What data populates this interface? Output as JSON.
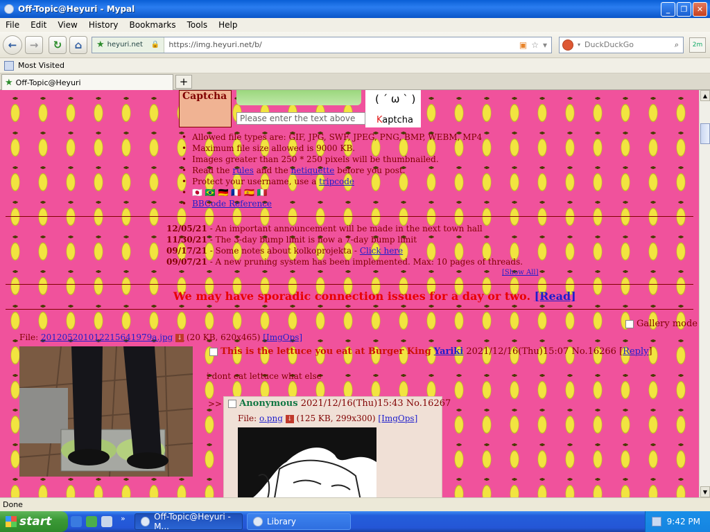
{
  "window": {
    "title": "Off-Topic@Heyuri - Mypal",
    "min": "_",
    "max": "❐",
    "close": "✕"
  },
  "menubar": [
    "File",
    "Edit",
    "View",
    "History",
    "Bookmarks",
    "Tools",
    "Help"
  ],
  "navbar": {
    "site": "heyuri.net",
    "url": "https://img.heyuri.net/b/",
    "search_placeholder": "DuckDuckGo",
    "end_btn": "2m"
  },
  "bookmarks": {
    "most_visited": "Most Visited"
  },
  "tab": {
    "title": "Off-Topic@Heyuri",
    "new_tab": "+"
  },
  "form": {
    "captcha_label": "Captcha",
    "captcha_placeholder": "Please enter the text above",
    "kaptcha_face": "( ´ ω ` )",
    "kaptcha_k": "K",
    "kaptcha_rest": "aptcha"
  },
  "rules": [
    "Allowed file types are: GIF, JPG, SWF, JPEG, PNG, BMP, WEBM, MP4",
    "Maximum file size allowed is 9000 KB.",
    "Images greater than 250 * 250 pixels will be thumbnailed.",
    {
      "pre": "Read the ",
      "l1": "rules",
      "mid": " and the ",
      "l2": "netiquette",
      "post": " before you post."
    },
    {
      "pre": "Protect your username, use a ",
      "l1": "tripcode"
    },
    "🇯🇵 🇧🇷 🇩🇪 🇫🇷 🇪🇸 🇮🇹",
    {
      "l1": "BBCode Reference"
    }
  ],
  "news": [
    {
      "date": "12/05/21",
      "text": " - An important announcement will be made in the next town hall"
    },
    {
      "date": "11/30/21",
      "text": " - The 3-day bump limit is now a 7-day bump limit"
    },
    {
      "date": "09/17/21",
      "text": " - Some notes about kolkoprojekta - ",
      "link": "Click here"
    },
    {
      "date": "09/07/21",
      "text": " - A new pruning system has been implemented. Max: 10 pages of threads."
    }
  ],
  "show_all": "[Show All]",
  "banner": {
    "text": "We may have sporadic connection issues for a day or two. ",
    "link": "[Read]"
  },
  "gallery": "Gallery mode",
  "thread": {
    "file_label": "File: ",
    "file_name": "201205201012215641979a.jpg",
    "file_meta": " (20 KB, 620x465) ",
    "imgops": "[ImgOps]",
    "subject": "This is the lettuce you eat at Burger King",
    "name": "Yariki",
    "datetime": "2021/12/16(Thu)15:07",
    "no": "No.16266",
    "reply": "Reply",
    "body": "i dont eat lettuce what else"
  },
  "reply": {
    "arrow": ">>",
    "name": "Anonymous",
    "datetime": "2021/12/16(Thu)15:43",
    "no": "No.16267",
    "file_label": "File: ",
    "file_name": "o.png",
    "file_meta": " (125 KB, 299x300) ",
    "imgops": "[ImgOps]"
  },
  "status": "Done",
  "taskbar": {
    "start": "start",
    "task1": "Off-Topic@Heyuri - M...",
    "task2": "Library",
    "clock": "9:42 PM"
  }
}
